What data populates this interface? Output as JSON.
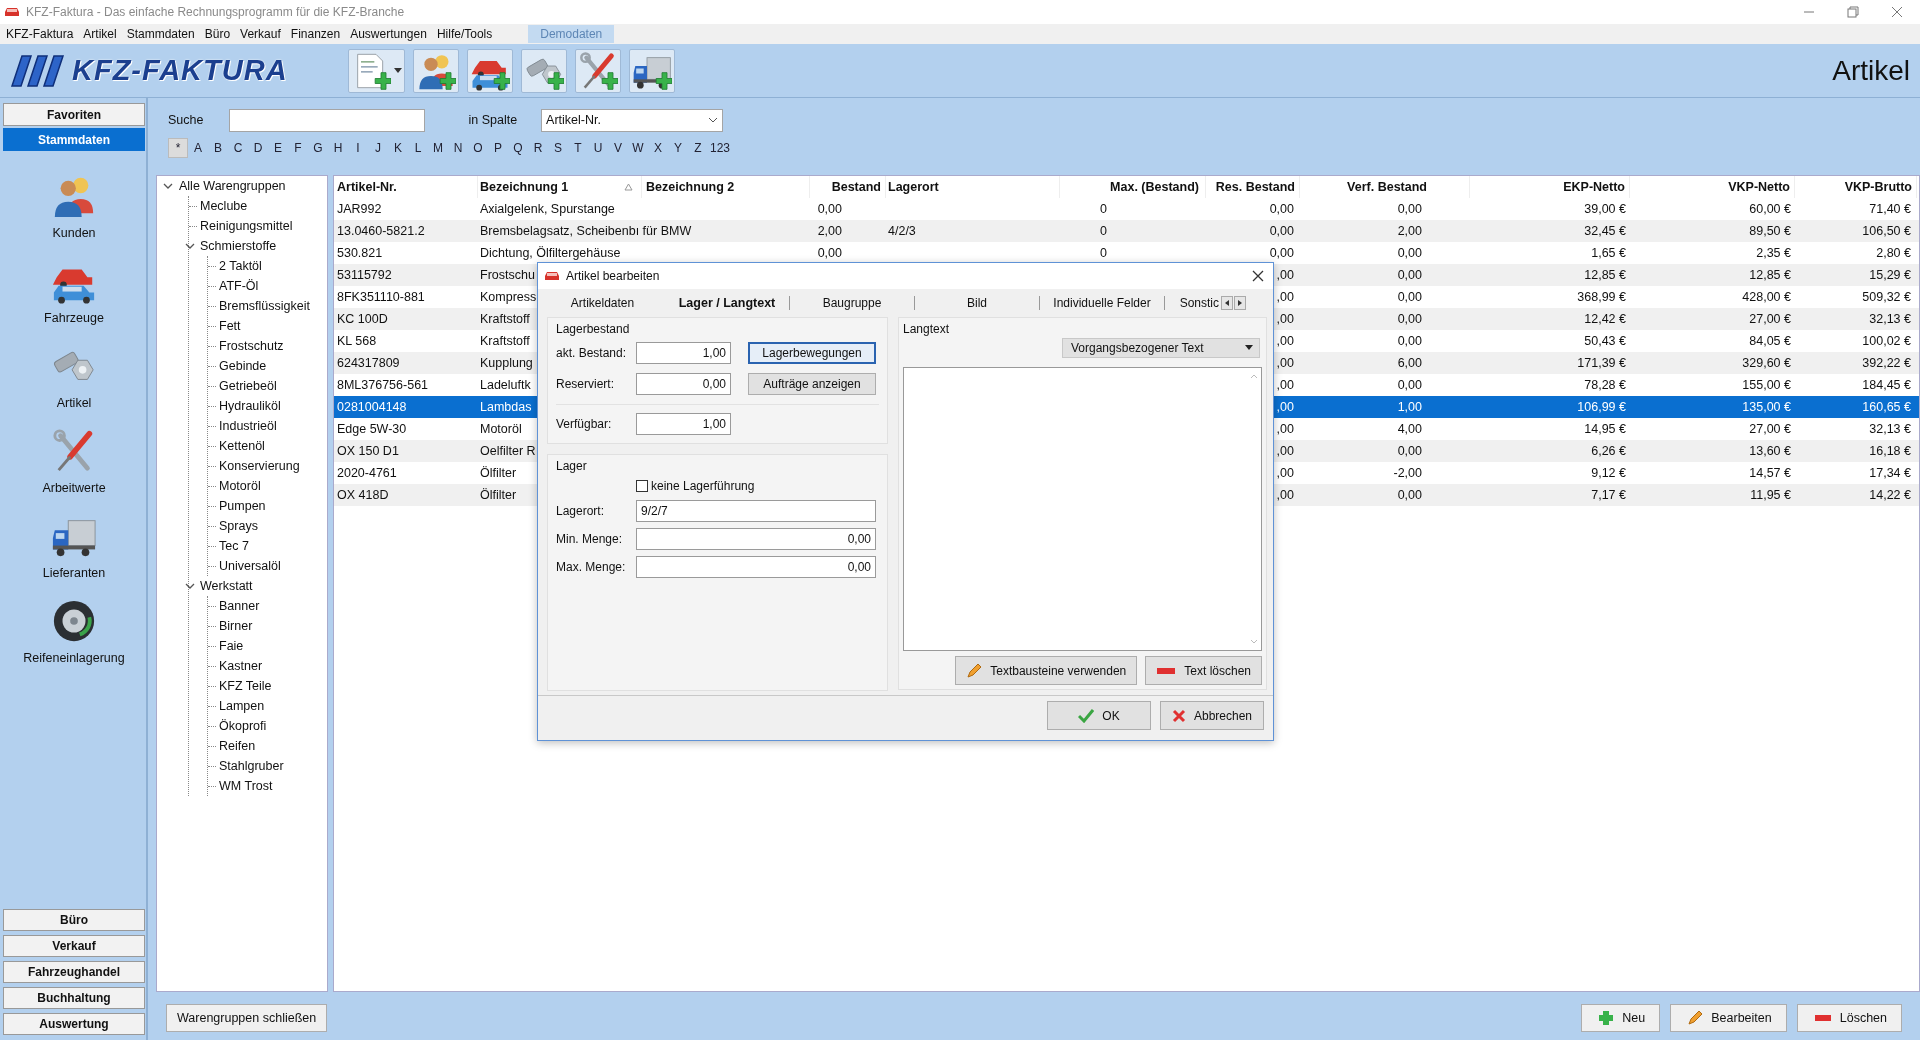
{
  "window": {
    "title": "KFZ-Faktura - Das einfache Rechnungsprogramm für die KFZ-Branche"
  },
  "menu": [
    "KFZ-Faktura",
    "Artikel",
    "Stammdaten",
    "Büro",
    "Verkauf",
    "Finanzen",
    "Auswertungen",
    "Hilfe/Tools"
  ],
  "demo_badge": "Demodaten",
  "header": {
    "logo": "KFZ-FAKTURA",
    "page_title": "Artikel"
  },
  "nav": {
    "tabs": [
      {
        "label": "Favoriten",
        "selected": false
      },
      {
        "label": "Stammdaten",
        "selected": true
      }
    ],
    "items": [
      "Kunden",
      "Fahrzeuge",
      "Artikel",
      "Arbeitwerte",
      "Lieferanten",
      "Reifeneinlagerung"
    ],
    "sections": [
      "Büro",
      "Verkauf",
      "Fahrzeughandel",
      "Buchhaltung",
      "Auswertung"
    ]
  },
  "search": {
    "label": "Suche",
    "column_label": "in Spalte",
    "column": "Artikel-Nr."
  },
  "letters": [
    {
      "label": "*",
      "selected": true
    },
    {
      "label": "A",
      "selected": false
    },
    {
      "label": "B",
      "selected": false
    },
    {
      "label": "C",
      "selected": false
    },
    {
      "label": "D",
      "selected": false
    },
    {
      "label": "E",
      "selected": false
    },
    {
      "label": "F",
      "selected": false
    },
    {
      "label": "G",
      "selected": false
    },
    {
      "label": "H",
      "selected": false
    },
    {
      "label": "I",
      "selected": false
    },
    {
      "label": "J",
      "selected": false
    },
    {
      "label": "K",
      "selected": false
    },
    {
      "label": "L",
      "selected": false
    },
    {
      "label": "M",
      "selected": false
    },
    {
      "label": "N",
      "selected": false
    },
    {
      "label": "O",
      "selected": false
    },
    {
      "label": "P",
      "selected": false
    },
    {
      "label": "Q",
      "selected": false
    },
    {
      "label": "R",
      "selected": false
    },
    {
      "label": "S",
      "selected": false
    },
    {
      "label": "T",
      "selected": false
    },
    {
      "label": "U",
      "selected": false
    },
    {
      "label": "V",
      "selected": false
    },
    {
      "label": "W",
      "selected": false
    },
    {
      "label": "X",
      "selected": false
    },
    {
      "label": "Y",
      "selected": false
    },
    {
      "label": "Z",
      "selected": false
    },
    {
      "label": "123",
      "selected": false
    }
  ],
  "tree": {
    "label": "Alle Warengruppen",
    "expanded": true,
    "children": [
      {
        "label": "Meclube"
      },
      {
        "label": "Reinigungsmittel"
      },
      {
        "label": "Schmierstoffe",
        "expanded": true,
        "children": [
          {
            "label": "2 Taktöl"
          },
          {
            "label": "ATF-Öl"
          },
          {
            "label": "Bremsflüssigkeit"
          },
          {
            "label": "Fett"
          },
          {
            "label": "Frostschutz"
          },
          {
            "label": "Gebinde"
          },
          {
            "label": "Getriebeöl"
          },
          {
            "label": "Hydrauliköl"
          },
          {
            "label": "Industrieöl"
          },
          {
            "label": "Kettenöl"
          },
          {
            "label": "Konservierung"
          },
          {
            "label": "Motoröl"
          },
          {
            "label": "Pumpen"
          },
          {
            "label": "Sprays"
          },
          {
            "label": "Tec 7"
          },
          {
            "label": "Universalöl"
          }
        ]
      },
      {
        "label": "Werkstatt",
        "expanded": true,
        "children": [
          {
            "label": "Banner"
          },
          {
            "label": "Birner"
          },
          {
            "label": "Faie"
          },
          {
            "label": "Kastner"
          },
          {
            "label": "KFZ Teile"
          },
          {
            "label": "Lampen"
          },
          {
            "label": "Ökoprofi"
          },
          {
            "label": "Reifen"
          },
          {
            "label": "Stahlgruber"
          },
          {
            "label": "WM Trost"
          }
        ]
      }
    ]
  },
  "table": {
    "columns": [
      {
        "label": "Artikel-Nr.",
        "sorted": false
      },
      {
        "label": "Bezeichnung 1",
        "sorted": true
      },
      {
        "label": "Bezeichnung 2",
        "sorted": false
      },
      {
        "label": "Bestand",
        "sorted": false
      },
      {
        "label": "Lagerort",
        "sorted": false
      },
      {
        "label": "Max. (Bestand)",
        "sorted": false
      },
      {
        "label": "Res. Bestand",
        "sorted": false
      },
      {
        "label": "Verf. Bestand",
        "sorted": false
      },
      {
        "label": "EKP-Netto",
        "sorted": false
      },
      {
        "label": "VKP-Netto",
        "sorted": false
      },
      {
        "label": "VKP-Brutto",
        "sorted": false
      }
    ],
    "rows": [
      {
        "selected": false,
        "cells": [
          "JAR992",
          "Axialgelenk, Spurstange",
          null,
          "0,00",
          null,
          "0",
          "0,00",
          "0,00",
          "39,00 €",
          "60,00 €",
          "71,40 €"
        ]
      },
      {
        "selected": false,
        "cells": [
          "13.0460-5821.2",
          "Bremsbelagsatz, Scheibenbı für BMW",
          null,
          "2,00",
          "4/2/3",
          "0",
          "0,00",
          "2,00",
          "32,45 €",
          "89,50 €",
          "106,50 €"
        ]
      },
      {
        "selected": false,
        "cells": [
          "530.821",
          "Dichtung, Ölfiltergehäuse",
          null,
          "0,00",
          null,
          "0",
          "0,00",
          "0,00",
          "1,65 €",
          "2,35 €",
          "2,80 €"
        ]
      },
      {
        "selected": false,
        "cells": [
          "53115792",
          "Frostschu",
          null,
          null,
          null,
          null,
          ",00",
          "0,00",
          "12,85 €",
          "12,85 €",
          "15,29 €"
        ]
      },
      {
        "selected": false,
        "cells": [
          "8FK351110-881",
          "Kompress",
          null,
          null,
          null,
          null,
          ",00",
          "0,00",
          "368,99 €",
          "428,00 €",
          "509,32 €"
        ]
      },
      {
        "selected": false,
        "cells": [
          "KC 100D",
          "Kraftstoff",
          null,
          null,
          null,
          null,
          ",00",
          "0,00",
          "12,42 €",
          "27,00 €",
          "32,13 €"
        ]
      },
      {
        "selected": false,
        "cells": [
          "KL 568",
          "Kraftstoff",
          null,
          null,
          null,
          null,
          ",00",
          "0,00",
          "50,43 €",
          "84,05 €",
          "100,02 €"
        ]
      },
      {
        "selected": false,
        "cells": [
          "624317809",
          "Kupplung",
          null,
          null,
          null,
          null,
          ",00",
          "6,00",
          "171,39 €",
          "329,60 €",
          "392,22 €"
        ]
      },
      {
        "selected": false,
        "cells": [
          "8ML376756-561",
          "Ladeluftk",
          null,
          null,
          null,
          null,
          ",00",
          "0,00",
          "78,28 €",
          "155,00 €",
          "184,45 €"
        ]
      },
      {
        "selected": true,
        "cells": [
          "0281004148",
          "Lambdas",
          null,
          null,
          null,
          null,
          ",00",
          "1,00",
          "106,99 €",
          "135,00 €",
          "160,65 €"
        ]
      },
      {
        "selected": false,
        "cells": [
          "Edge 5W-30",
          "Motoröl",
          null,
          null,
          null,
          null,
          ",00",
          "4,00",
          "14,95 €",
          "27,00 €",
          "32,13 €"
        ]
      },
      {
        "selected": false,
        "cells": [
          "OX 150 D1",
          "Oelfilter R",
          null,
          null,
          null,
          null,
          ",00",
          "0,00",
          "6,26 €",
          "13,60 €",
          "16,18 €"
        ]
      },
      {
        "selected": false,
        "cells": [
          "2020-4761",
          "Ölfilter",
          null,
          null,
          null,
          null,
          ",00",
          "-2,00",
          "9,12 €",
          "14,57 €",
          "17,34 €"
        ]
      },
      {
        "selected": false,
        "cells": [
          "OX 418D",
          "Ölfilter",
          null,
          null,
          null,
          null,
          ",00",
          "0,00",
          "7,17 €",
          "11,95 €",
          "14,22 €"
        ]
      }
    ]
  },
  "bottom": {
    "collapse_button": "Warengruppen schließen",
    "buttons": [
      {
        "kind": "new",
        "label": "Neu"
      },
      {
        "kind": "edit",
        "label": "Bearbeiten"
      },
      {
        "kind": "delete",
        "label": "Löschen"
      }
    ]
  },
  "dialog": {
    "title": "Artikel bearbeiten",
    "tabs": [
      {
        "label": "Artikeldaten",
        "selected": false
      },
      {
        "label": "Lager / Langtext",
        "selected": true
      },
      {
        "label": "Baugruppe",
        "selected": false
      },
      {
        "label": "Bild",
        "selected": false
      },
      {
        "label": "Individuelle Felder",
        "selected": false
      },
      {
        "label": "Sonstic",
        "selected": false
      }
    ],
    "stock_group": {
      "title": "Lagerbestand",
      "fields": [
        {
          "label": "akt. Bestand:",
          "value": "1,00"
        },
        {
          "label": "Reserviert:",
          "value": "0,00"
        },
        {
          "label": "Verfügbar:",
          "value": "1,00"
        }
      ],
      "buttons": [
        {
          "label": "Lagerbewegungen",
          "focused": true
        },
        {
          "label": "Aufträge anzeigen",
          "focused": false
        }
      ]
    },
    "storage_group": {
      "title": "Lager",
      "checkbox": {
        "label": "keine Lagerführung",
        "checked": false
      },
      "fields": [
        {
          "kind": "text",
          "label": "Lagerort:",
          "value": "9/2/7"
        },
        {
          "kind": "number",
          "label": "Min. Menge:",
          "value": "0,00"
        },
        {
          "kind": "number",
          "label": "Max. Menge:",
          "value": "0,00"
        }
      ]
    },
    "langtext": {
      "title": "Langtext",
      "mode": "Vorgangsbezogener Text",
      "buttons": [
        {
          "kind": "snippets",
          "label": "Textbausteine verwenden"
        },
        {
          "kind": "clear",
          "label": "Text löschen"
        }
      ]
    },
    "footer_buttons": [
      {
        "kind": "ok",
        "label": "OK"
      },
      {
        "kind": "cancel",
        "label": "Abbrechen"
      }
    ]
  }
}
